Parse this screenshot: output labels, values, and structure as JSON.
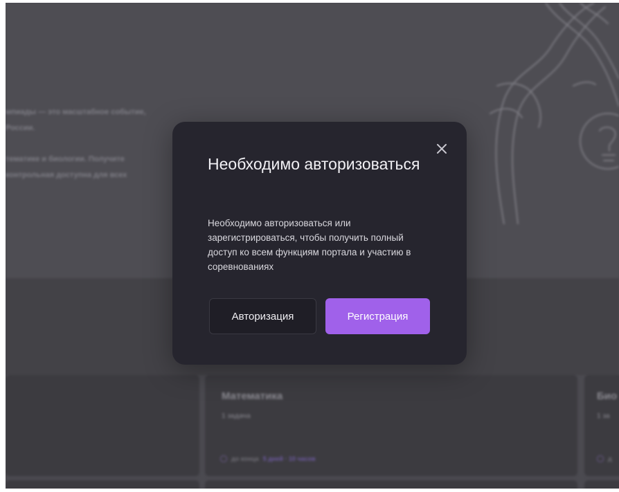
{
  "background": {
    "hero_lines": [
      "мпиады — это масштабное событие,",
      "России.",
      "тематике и биологии. Получите",
      "контрольная доступна для всех"
    ],
    "cards": [
      {
        "title": "Математика",
        "subtitle": "1 задача",
        "meta_label": "до конца",
        "meta_value": "5 дней · 10 часов"
      },
      {
        "title": "Био",
        "subtitle": "1 за",
        "meta_label": "д",
        "meta_value": ""
      }
    ]
  },
  "modal": {
    "title": "Необходимо авторизоваться",
    "description": "Необходимо авторизоваться или зарегистрироваться, чтобы получить полный доступ ко всем функциям портала и участию в соревнованиях",
    "login_label": "Авторизация",
    "register_label": "Регистрация",
    "close_icon": "close-icon"
  },
  "colors": {
    "overlay": "#4b4a50",
    "modal_bg": "#26252e",
    "accent": "#a061ea",
    "login_bg": "#1f1e26"
  }
}
